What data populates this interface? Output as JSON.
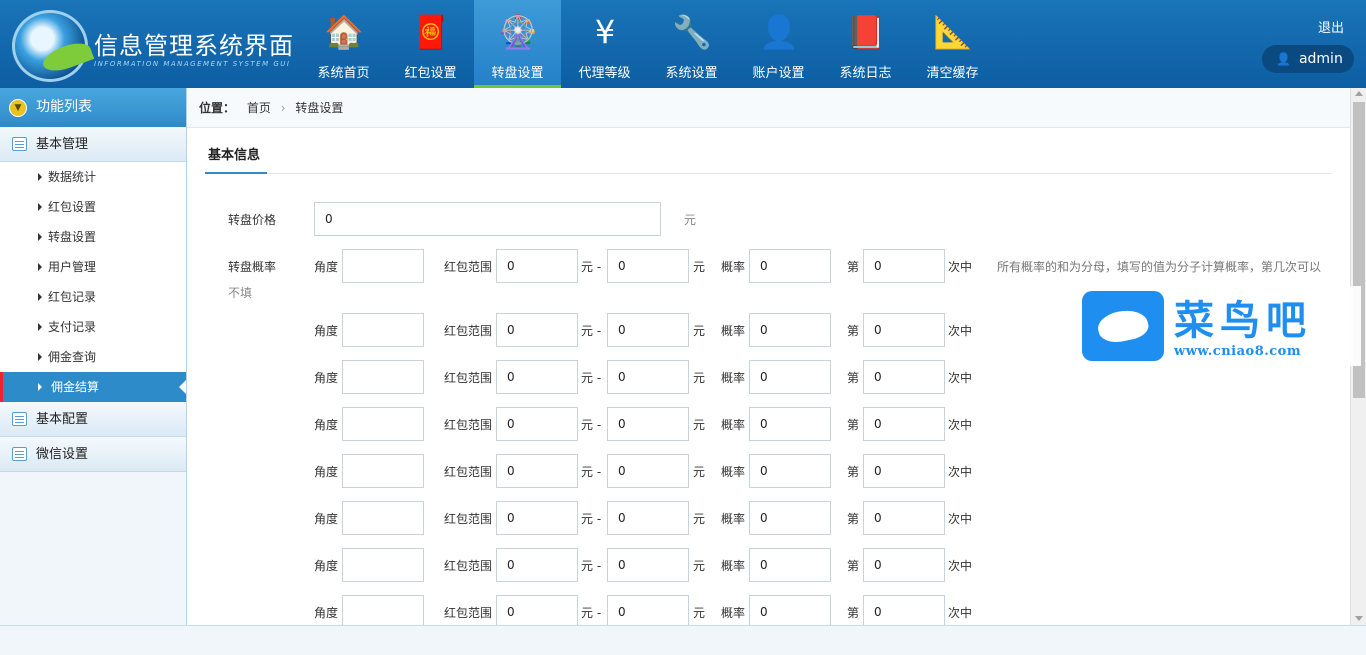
{
  "header": {
    "title": "信息管理系统界面",
    "subtitle": "INFORMATION MANAGEMENT SYSTEM GUI",
    "logout": "退出",
    "user": "admin",
    "nav": [
      {
        "label": "系统首页",
        "icon": "home-icon",
        "glyph": "🏠"
      },
      {
        "label": "红包设置",
        "icon": "red-envelope-icon",
        "glyph": "🧧"
      },
      {
        "label": "转盘设置",
        "icon": "wheel-icon",
        "glyph": "🎡",
        "active": true
      },
      {
        "label": "代理等级",
        "icon": "yuan-cloud-icon",
        "glyph": "¥"
      },
      {
        "label": "系统设置",
        "icon": "tools-icon",
        "glyph": "🔧"
      },
      {
        "label": "账户设置",
        "icon": "user-icon",
        "glyph": "👤"
      },
      {
        "label": "系统日志",
        "icon": "book-icon",
        "glyph": "📕"
      },
      {
        "label": "清空缓存",
        "icon": "clear-cache-icon",
        "glyph": "📐"
      }
    ]
  },
  "sidebar": {
    "head": "功能列表",
    "groups": [
      {
        "label": "基本管理",
        "items": [
          "数据统计",
          "红包设置",
          "转盘设置",
          "用户管理",
          "红包记录",
          "支付记录",
          "佣金查询",
          "佣金结算"
        ]
      },
      {
        "label": "基本配置"
      },
      {
        "label": "微信设置"
      }
    ],
    "active_item": "佣金结算"
  },
  "breadcrumb": {
    "prefix": "位置：",
    "home": "首页",
    "sep": "›",
    "current": "转盘设置"
  },
  "tab": "基本信息",
  "form": {
    "price_label": "转盘价格",
    "price_value": "0",
    "price_unit": "元",
    "rate_label": "转盘概率",
    "rate_note_tail": "不填",
    "rate_note": "所有概率的和为分母，填写的值为分子计算概率，第几次可以",
    "labels": {
      "angle": "角度",
      "range": "红包范围",
      "yuan_dash": "元 -",
      "yuan": "元",
      "prob": "概率",
      "nth": "第",
      "hit": "次中"
    },
    "rows": [
      {
        "angle": "",
        "min": "0",
        "max": "0",
        "prob": "0",
        "nth": "0"
      },
      {
        "angle": "",
        "min": "0",
        "max": "0",
        "prob": "0",
        "nth": "0"
      },
      {
        "angle": "",
        "min": "0",
        "max": "0",
        "prob": "0",
        "nth": "0"
      },
      {
        "angle": "",
        "min": "0",
        "max": "0",
        "prob": "0",
        "nth": "0"
      },
      {
        "angle": "",
        "min": "0",
        "max": "0",
        "prob": "0",
        "nth": "0"
      },
      {
        "angle": "",
        "min": "0",
        "max": "0",
        "prob": "0",
        "nth": "0"
      },
      {
        "angle": "",
        "min": "0",
        "max": "0",
        "prob": "0",
        "nth": "0"
      },
      {
        "angle": "",
        "min": "0",
        "max": "0",
        "prob": "0",
        "nth": "0"
      }
    ]
  },
  "watermark": {
    "title": "菜鸟吧",
    "url": "www.cniao8.com"
  }
}
